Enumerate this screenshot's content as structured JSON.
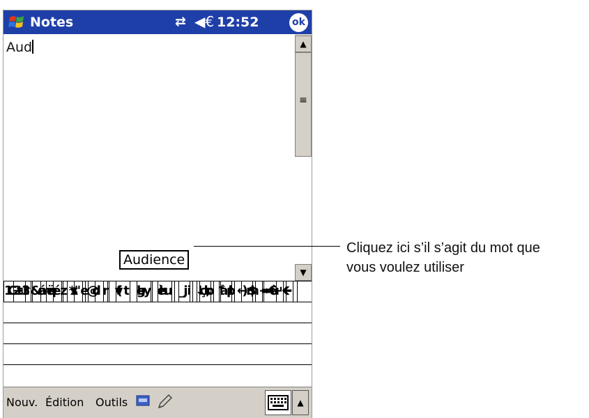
{
  "titlebar": {
    "app_title": "Notes",
    "clock": "12:52",
    "ok_label": "ok",
    "connectivity_glyph": "⇄",
    "volume_glyph": "◀€"
  },
  "note": {
    "text": "Aud",
    "suggestion": "Audience"
  },
  "keyboard": {
    "rows": [
      [
        "123",
        "&",
        "é",
        "\"",
        "'",
        "(",
        "-",
        "è",
        "_",
        "ç",
        "à",
        ")",
        "=",
        "🡸"
      ],
      [
        "⇥",
        "a",
        "z",
        "e",
        "r",
        "t",
        "y",
        "u",
        "i",
        "o",
        "p",
        "$",
        "€"
      ],
      [
        "⇪",
        "q",
        "s",
        "d",
        "f",
        "g",
        "h",
        "j",
        "k",
        "l",
        "m",
        "ù"
      ],
      [
        "⇧",
        "w",
        "x",
        "c",
        "v",
        "b",
        "n",
        ",",
        ";",
        ":",
        "!",
        "↵"
      ],
      [
        "Ctl",
        "áë",
        "*",
        "@",
        "",
        "↓",
        "↑",
        "←",
        "→"
      ]
    ]
  },
  "menubar": {
    "new_label": "Nouv.",
    "edit_label": "Édition",
    "tools_label": "Outils"
  },
  "callout": {
    "line1": "Cliquez ici s’il s’agit du mot que",
    "line2": "vous voulez utiliser"
  },
  "icons": {
    "start": "windows-flag-icon",
    "keyboard": "keyboard-icon",
    "pen": "pen-icon"
  },
  "colors": {
    "titlebar": "#1f3fa8",
    "accent": "#1f3fa8"
  }
}
